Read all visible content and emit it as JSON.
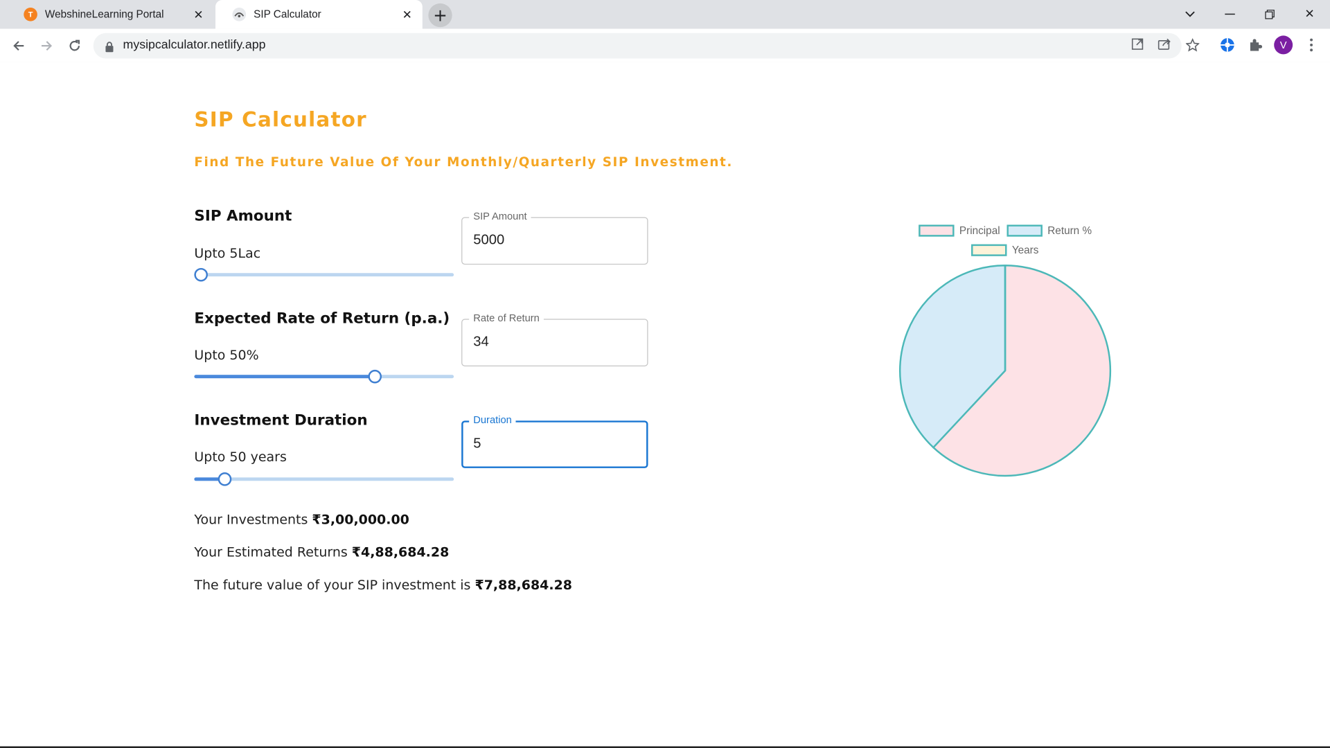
{
  "browser": {
    "tabs": [
      {
        "title": "WebshineLearning Portal",
        "active": false
      },
      {
        "title": "SIP Calculator",
        "active": true
      }
    ],
    "url": "mysipcalculator.netlify.app",
    "profile_initial": "V"
  },
  "page": {
    "title": "SIP Calculator",
    "subtitle": "Find The Future Value Of Your Monthly/Quarterly SIP Investment.",
    "fields": [
      {
        "title": "SIP Amount",
        "limit": "Upto 5Lac",
        "input_label": "SIP Amount",
        "input_value": "5000",
        "slider_fraction": 0.01
      },
      {
        "title": "Expected Rate of Return (p.a.)",
        "limit": "Upto 50%",
        "input_label": "Rate of Return",
        "input_value": "34",
        "slider_fraction": 0.68
      },
      {
        "title": "Investment Duration",
        "limit": "Upto 50 years",
        "input_label": "Duration",
        "input_value": "5",
        "slider_fraction": 0.1
      }
    ],
    "results": {
      "investments_label": "Your Investments",
      "investments_value": "₹3,00,000.00",
      "returns_label": "Your Estimated Returns",
      "returns_value": "₹4,88,684.28",
      "future_label": "The future value of your SIP investment is",
      "future_value": "₹7,88,684.28"
    }
  },
  "chart_data": {
    "type": "pie",
    "categories": [
      "Principal",
      "Return %",
      "Years"
    ],
    "values": [
      488684.28,
      300000,
      34
    ],
    "colors": [
      "#fde2e6",
      "#d6ebf8",
      "#fdf3d9"
    ],
    "border_color": "#4cb8b8",
    "legend_position": "top"
  }
}
